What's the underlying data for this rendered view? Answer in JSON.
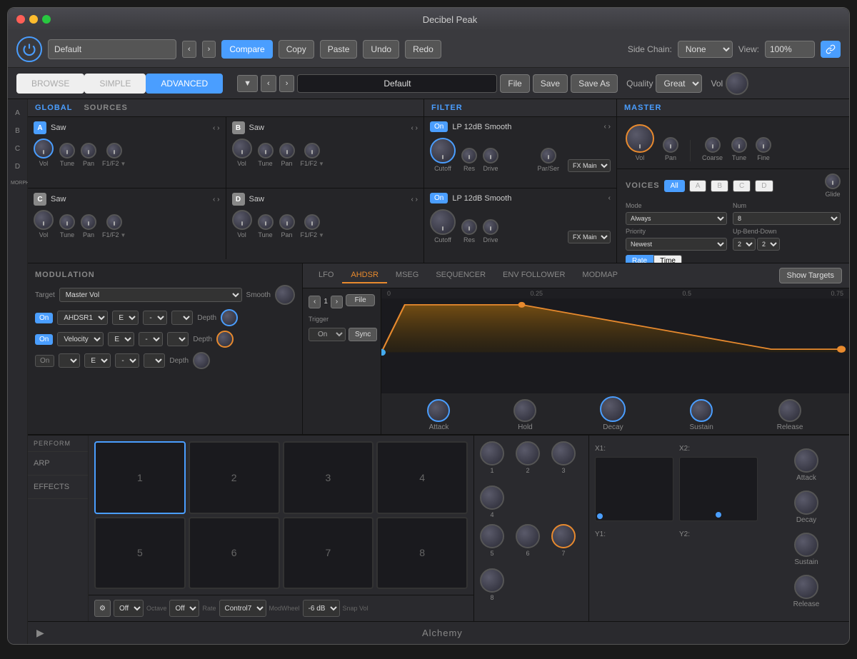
{
  "window": {
    "title": "Decibel Peak",
    "traffic_lights": [
      "close",
      "minimize",
      "maximize"
    ]
  },
  "toolbar": {
    "preset_value": "Default",
    "compare_label": "Compare",
    "copy_label": "Copy",
    "paste_label": "Paste",
    "undo_label": "Undo",
    "redo_label": "Redo",
    "side_chain_label": "Side Chain:",
    "side_chain_value": "None",
    "view_label": "View:",
    "view_value": "100%"
  },
  "mode_bar": {
    "tabs": [
      "BROWSE",
      "SIMPLE",
      "ADVANCED"
    ],
    "active": "ADVANCED",
    "preset_name": "Default",
    "file_btn": "File",
    "save_btn": "Save",
    "saveas_btn": "Save As",
    "quality_label": "Quality",
    "quality_value": "Great",
    "vol_label": "Vol"
  },
  "global": {
    "label": "GLOBAL",
    "rows": [
      "A",
      "B",
      "C",
      "D",
      "MORPH"
    ]
  },
  "sources": {
    "title": "SOURCES",
    "cells": [
      {
        "id": "A",
        "type": "Saw",
        "color": "blue"
      },
      {
        "id": "B",
        "type": "Saw",
        "color": "gray"
      },
      {
        "id": "C",
        "type": "Saw",
        "color": "gray"
      },
      {
        "id": "D",
        "type": "Saw",
        "color": "gray"
      }
    ],
    "knob_labels": [
      "Vol",
      "Tune",
      "Pan",
      "F1/F2"
    ]
  },
  "filter": {
    "title": "FILTER",
    "sections": [
      {
        "on": true,
        "type": "LP 12dB Smooth",
        "knobs": [
          "Cutoff",
          "Res",
          "Drive"
        ],
        "fx": "FX Main"
      },
      {
        "on": true,
        "type": "LP 12dB Smooth",
        "knobs": [
          "Cutoff",
          "Res",
          "Drive"
        ],
        "fx": "FX Main"
      }
    ],
    "par_ser_label": "Par/Ser"
  },
  "master": {
    "title": "MASTER",
    "knobs": [
      "Vol",
      "Pan",
      "Coarse",
      "Tune",
      "Fine"
    ]
  },
  "voices": {
    "title": "VOICES",
    "tabs": [
      "All",
      "A",
      "B",
      "C",
      "D"
    ],
    "mode_label": "Mode",
    "mode_value": "Always",
    "num_label": "Num",
    "num_value": "8",
    "priority_label": "Priority",
    "priority_value": "Newest",
    "v2_label": "2",
    "v2b_label": "2",
    "up_bend_label": "Up-Bend-Down",
    "glide_label": "Glide",
    "rate_label": "Rate",
    "time_label": "Time"
  },
  "modulation": {
    "title": "MODULATION",
    "target_label": "Target",
    "target_value": "Master Vol",
    "smooth_label": "Smooth",
    "rows": [
      {
        "on": true,
        "source": "AHDSR1",
        "e": "E",
        "depth_label": "Depth"
      },
      {
        "on": true,
        "source": "Velocity",
        "e": "E",
        "depth_label": "Depth"
      },
      {
        "on": false,
        "source": "",
        "e": "E",
        "depth_label": "Depth"
      }
    ]
  },
  "lfo_ahdsr": {
    "tabs": [
      "LFO",
      "AHDSR",
      "MSEG",
      "SEQUENCER",
      "ENV FOLLOWER",
      "MODMAP"
    ],
    "active": "AHDSR",
    "show_targets": "Show Targets",
    "ahdsr": {
      "num": "1",
      "file_btn": "File",
      "on_label": "On",
      "sync_btn": "Sync",
      "trigger_label": "Trigger"
    },
    "ruler": [
      "0",
      "0.25",
      "0.5",
      "0.75"
    ],
    "env_knobs": [
      "Attack",
      "Hold",
      "Decay",
      "Sustain",
      "Release"
    ]
  },
  "perform": {
    "title": "PERFORM",
    "tabs": [
      "ARP",
      "EFFECTS"
    ],
    "pads": [
      1,
      2,
      3,
      4,
      5,
      6,
      7,
      8
    ],
    "selected_pad": 1,
    "octave_label": "Octave",
    "rate_label": "Rate",
    "modwheel_label": "ModWheel",
    "snap_vol_label": "Snap Vol",
    "octave_value": "Off",
    "rate_value": "Off",
    "modwheel_value": "Control7",
    "snap_vol_value": "-6 dB"
  },
  "macros": {
    "knobs": [
      1,
      2,
      3,
      4,
      5,
      6,
      7,
      8
    ],
    "active_knob": 7,
    "x1_label": "X1:",
    "x2_label": "X2:",
    "y1_label": "Y1:",
    "y2_label": "Y2:"
  },
  "right_controls": {
    "attack_label": "Attack",
    "decay_label": "Decay",
    "sustain_label": "Sustain",
    "release_label": "Release"
  },
  "bottom": {
    "title": "Alchemy"
  }
}
